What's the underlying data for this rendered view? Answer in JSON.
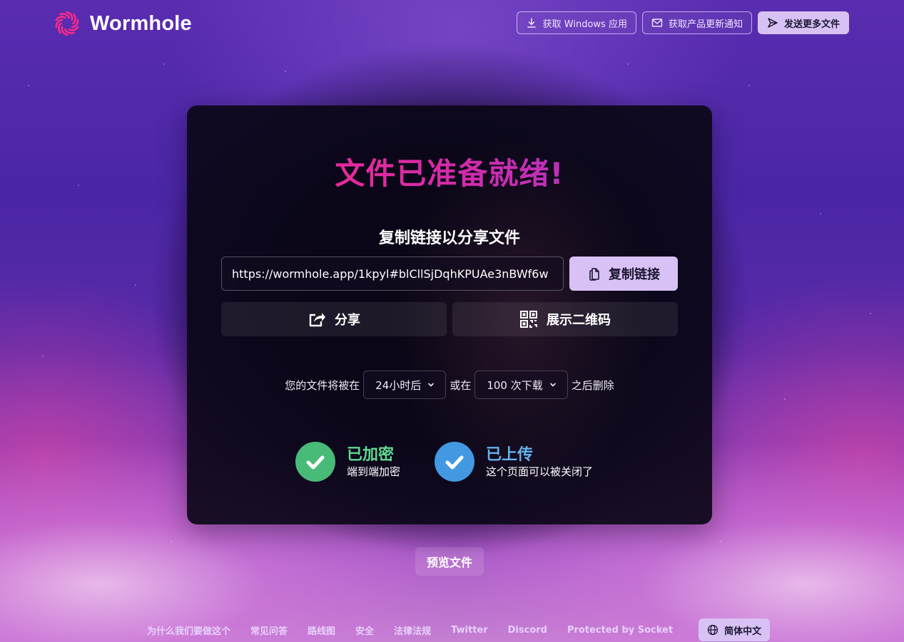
{
  "header": {
    "logo_text": "Wormhole",
    "actions": [
      {
        "label": "获取 Windows 应用",
        "icon": "download-icon"
      },
      {
        "label": "获取产品更新通知",
        "icon": "mail-icon"
      },
      {
        "label": "发送更多文件",
        "icon": "send-icon"
      }
    ]
  },
  "card": {
    "title": "文件已准备就绪!",
    "subtitle": "复制链接以分享文件",
    "link_value": "https://wormhole.app/1kpyl#blCllSjDqhKPUAe3nBWf6w",
    "copy_label": "复制链接",
    "share_label": "分享",
    "qr_label": "展示二维码",
    "expire": {
      "prefix": "您的文件将被在",
      "time_value": "24小时后",
      "middle": "或在",
      "downloads_value": "100 次下载",
      "suffix": "之后删除"
    },
    "statuses": [
      {
        "title": "已加密",
        "subtitle": "端到端加密",
        "color": "#48bb78"
      },
      {
        "title": "已上传",
        "subtitle": "这个页面可以被关闭了",
        "color": "#4299e1"
      }
    ]
  },
  "preview_label": "预览文件",
  "footer": {
    "links": [
      "为什么我们要做这个",
      "常见问答",
      "路线图",
      "安全",
      "法律法规",
      "Twitter",
      "Discord",
      "Protected by Socket"
    ],
    "language": "简体中文"
  },
  "colors": {
    "accent": "#d8c2f5",
    "brand_pink": "#ff2a8a",
    "success_green": "#48bb78",
    "info_blue": "#4299e1"
  }
}
